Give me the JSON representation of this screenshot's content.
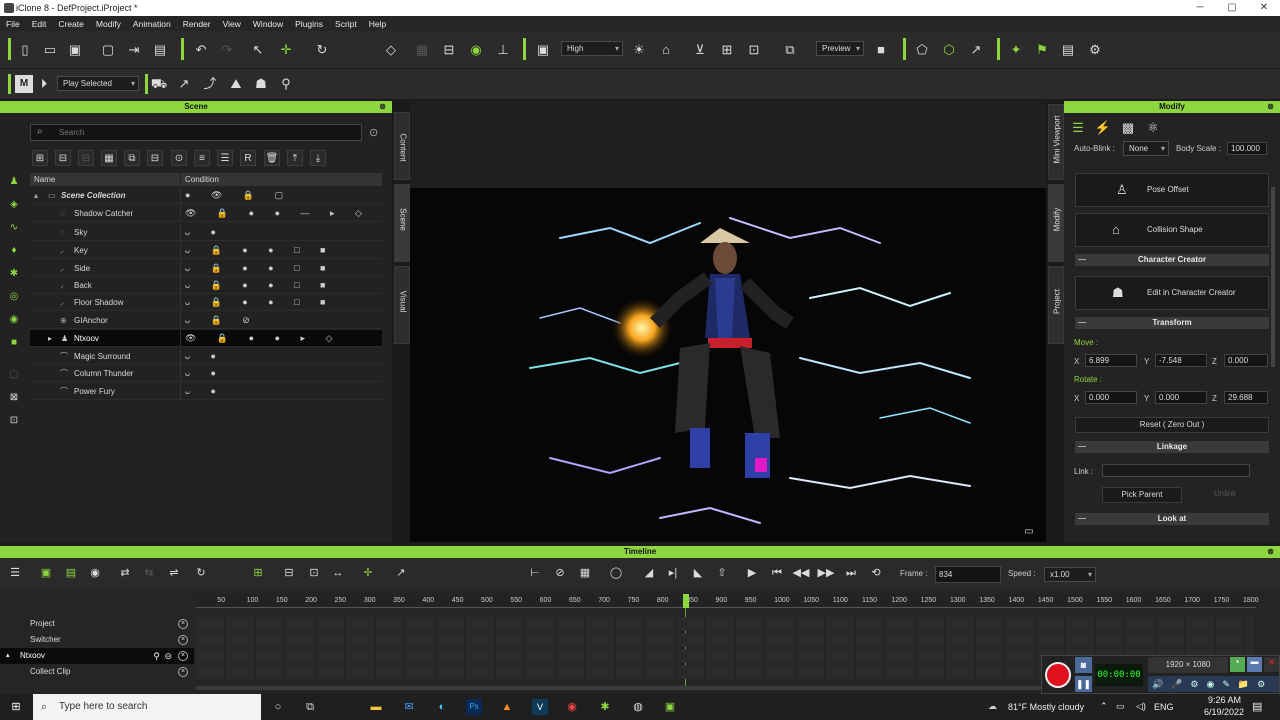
{
  "window": {
    "title": "iClone 8 - DefProject.iProject *",
    "min": "─",
    "max": "▢",
    "close": "✕"
  },
  "menu": [
    "File",
    "Edit",
    "Create",
    "Modify",
    "Animation",
    "Render",
    "View",
    "Window",
    "Plugins",
    "Script",
    "Help"
  ],
  "toolbar": {
    "quality": "High",
    "preview": "Preview"
  },
  "toolbar2": {
    "play_mode": "Play Selected"
  },
  "scene": {
    "title": "Scene",
    "search_placeholder": "Search",
    "col_name": "Name",
    "col_condition": "Condition",
    "items": [
      {
        "name": "Scene Collection",
        "cond": "● 👁 🔒 ▢"
      },
      {
        "name": "Shadow Catcher",
        "cond": "👁 🔒 ● ● — ▸ ◇"
      },
      {
        "name": "Sky",
        "cond": "ᴗ ●"
      },
      {
        "name": "Key",
        "cond": "ᴗ 🔒 ● ● □ ■"
      },
      {
        "name": "Side",
        "cond": "ᴗ 🔒 ● ● □ ■"
      },
      {
        "name": "Back",
        "cond": "ᴗ 🔒 ● ● □ ■"
      },
      {
        "name": "Floor Shadow",
        "cond": "ᴗ 🔒 ● ● □ ■"
      },
      {
        "name": "GIAnchor",
        "cond": "ᴗ 🔒 ⊘"
      },
      {
        "name": "Ntxoov",
        "cond": "👁 🔒 ● ● ▸ ◇"
      },
      {
        "name": "Magic Surround",
        "cond": "ᴗ ●"
      },
      {
        "name": "Column Thunder",
        "cond": "ᴗ ●"
      },
      {
        "name": "Power Fury",
        "cond": "ᴗ ●"
      }
    ]
  },
  "sidetabs": {
    "content": "Content",
    "scene": "Scene",
    "visual": "Visual",
    "mini": "Mini Viewport",
    "modify": "Modify",
    "project": "Project"
  },
  "modify": {
    "title": "Modify",
    "auto_blink_label": "Auto-Blink :",
    "auto_blink_value": "None",
    "body_scale_label": "Body Scale :",
    "body_scale_value": "100.000",
    "pose_offset": "Pose Offset",
    "collision_shape": "Collision Shape",
    "character_creator": "Character Creator",
    "edit_in_cc": "Edit in Character Creator",
    "transform": "Transform",
    "move_label": "Move :",
    "move": {
      "x": "6.899",
      "y": "-7.548",
      "z": "0.000"
    },
    "rotate_label": "Rotate :",
    "rotate": {
      "x": "0.000",
      "y": "0.000",
      "z": "29.688"
    },
    "reset": "Reset ( Zero Out )",
    "linkage": "Linkage",
    "link_label": "Link :",
    "pick_parent": "Pick Parent",
    "unlink": "Unlink",
    "look_at": "Look at",
    "axis_x": "X",
    "axis_y": "Y",
    "axis_z": "Z"
  },
  "timeline": {
    "title": "Timeline",
    "frame_label": "Frame :",
    "frame_value": "834",
    "speed_label": "Speed :",
    "speed_value": "x1.00",
    "ticks": [
      "50",
      "100",
      "150",
      "200",
      "250",
      "300",
      "350",
      "400",
      "450",
      "500",
      "550",
      "600",
      "650",
      "700",
      "750",
      "800",
      "850",
      "900",
      "950",
      "1000",
      "1050",
      "1100",
      "1150",
      "1200",
      "1250",
      "1300",
      "1350",
      "1400",
      "1450",
      "1500",
      "1550",
      "1600",
      "1650",
      "1700",
      "1750",
      "1800"
    ],
    "playhead_frame": 834,
    "max_frame": 1800,
    "tracks": [
      {
        "name": "Project"
      },
      {
        "name": "Switcher"
      },
      {
        "name": "Ntxoov",
        "selected": true
      },
      {
        "name": "Collect Clip"
      }
    ]
  },
  "recorder": {
    "resolution": "1920 × 1080",
    "timer": "00:00:00"
  },
  "taskbar": {
    "search_placeholder": "Type here to search",
    "weather": "81°F  Mostly cloudy",
    "lang": "ENG",
    "time": "9:26 AM",
    "date": "6/19/2022"
  },
  "colors": {
    "accent": "#8dd63f",
    "panel": "#232323",
    "dark": "#1b1b1b"
  }
}
